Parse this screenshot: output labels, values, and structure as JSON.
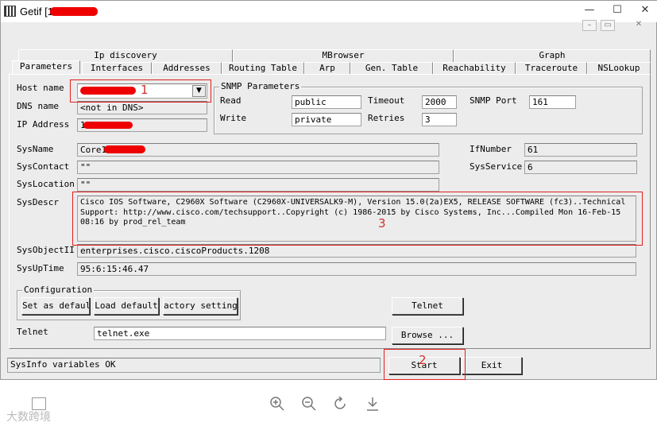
{
  "window": {
    "title": "Getif [1",
    "caption_buttons": [
      "—",
      "☐",
      "✕"
    ]
  },
  "tabs_row1": [
    "Ip discovery",
    "MBrowser",
    "Graph"
  ],
  "tabs_row2": [
    "Parameters",
    "Interfaces",
    "Addresses",
    "Routing Table",
    "Arp",
    "Gen. Table",
    "Reachability",
    "Traceroute",
    "NSLookup"
  ],
  "form": {
    "host_name_label": "Host name",
    "dns_name_label": "DNS name",
    "dns_name_value": "<not in DNS>",
    "ip_address_label": "IP Address",
    "ip_address_value": "1",
    "sysname_label": "SysName",
    "sysname_value": "Core10",
    "syscontact_label": "SysContact",
    "syscontact_value": "\"\"",
    "syslocation_label": "SysLocation",
    "syslocation_value": "\"\"",
    "sysdescr_label": "SysDescr",
    "sysdescr_value": "Cisco IOS Software, C2960X Software (C2960X-UNIVERSALK9-M), Version 15.0(2a)EX5, RELEASE SOFTWARE (fc3)..Technical Support: http://www.cisco.com/techsupport..Copyright (c) 1986-2015 by Cisco Systems, Inc...Compiled Mon 16-Feb-15 08:16 by prod_rel_team",
    "sysobjectid_label": "SysObjectII",
    "sysobjectid_value": "enterprises.cisco.ciscoProducts.1208",
    "sysuptime_label": "SysUpTime",
    "sysuptime_value": "95:6:15:46.47",
    "ifnumber_label": "IfNumber",
    "ifnumber_value": "61",
    "sysservice_label": "SysService:",
    "sysservice_value": "6"
  },
  "snmp": {
    "title": "SNMP Parameters",
    "read_label": "Read",
    "read_value": "public",
    "write_label": "Write",
    "write_value": "private",
    "timeout_label": "Timeout",
    "timeout_value": "2000",
    "retries_label": "Retries",
    "retries_value": "3",
    "port_label": "SNMP Port",
    "port_value": "161"
  },
  "configuration": {
    "title": "Configuration",
    "set_default": "Set as default",
    "load_default": "Load default",
    "factory_setting": "actory setting"
  },
  "telnet": {
    "button": "Telnet",
    "label": "Telnet",
    "path_value": "telnet.exe",
    "browse": "Browse ..."
  },
  "bottom": {
    "status": "SysInfo variables OK",
    "start": "Start",
    "exit": "Exit"
  },
  "annotations": {
    "mark1": "1",
    "mark2": "2",
    "mark3": "3"
  },
  "watermark": "大数跨境",
  "viewer_icons": [
    "zoom-in-icon",
    "zoom-out-icon",
    "rotate-icon",
    "download-icon"
  ]
}
